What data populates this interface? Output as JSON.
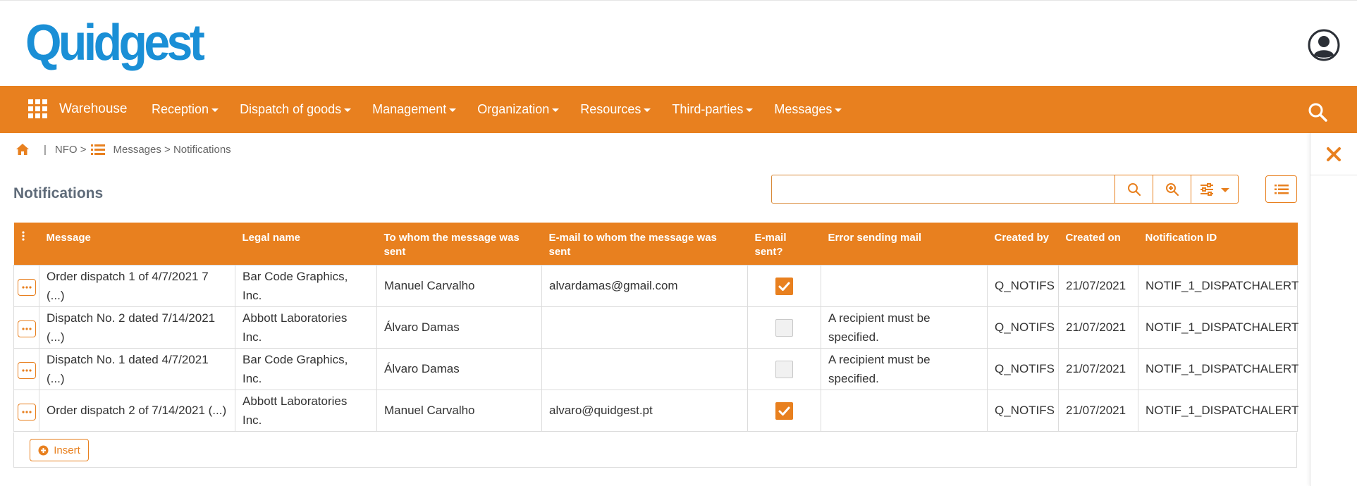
{
  "header": {
    "logo_text": "Quidgest",
    "icons": {
      "avatar": "user-avatar-icon",
      "apps": "grid-apps-icon",
      "search": "search-icon",
      "close": "close-icon"
    }
  },
  "nav": {
    "brand": "Warehouse",
    "items": [
      {
        "label": "Reception"
      },
      {
        "label": "Dispatch of goods"
      },
      {
        "label": "Management"
      },
      {
        "label": "Organization"
      },
      {
        "label": "Resources"
      },
      {
        "label": "Third-parties"
      },
      {
        "label": "Messages"
      }
    ]
  },
  "breadcrumb": {
    "separator": "|",
    "module": "NFO >",
    "path": "Messages > Notifications"
  },
  "page": {
    "title": "Notifications",
    "search_value": ""
  },
  "table": {
    "columns": [
      {
        "label": "Message"
      },
      {
        "label": "Legal name"
      },
      {
        "label": "To whom the message was sent"
      },
      {
        "label": "E-mail to whom the message was sent"
      },
      {
        "label": "E-mail sent?"
      },
      {
        "label": "Error sending mail"
      },
      {
        "label": "Created by"
      },
      {
        "label": "Created on"
      },
      {
        "label": "Notification ID"
      }
    ],
    "rows": [
      {
        "message": "Order dispatch 1 of 4/7/2021 7 (...)",
        "legal_name": "Bar Code Graphics, Inc.",
        "to_whom": "Manuel Carvalho",
        "email": "alvardamas@gmail.com",
        "sent": true,
        "error": "",
        "created_by": "Q_NOTIFS",
        "created_on": "21/07/2021",
        "notification_id": "NOTIF_1_DISPATCHALERT"
      },
      {
        "message": "Dispatch No. 2 dated 7/14/2021 (...)",
        "legal_name": "Abbott Laboratories Inc.",
        "to_whom": "Álvaro Damas",
        "email": "",
        "sent": false,
        "error": "A recipient must be specified.",
        "created_by": "Q_NOTIFS",
        "created_on": "21/07/2021",
        "notification_id": "NOTIF_1_DISPATCHALERT"
      },
      {
        "message": "Dispatch No. 1 dated 4/7/2021 (...)",
        "legal_name": "Bar Code Graphics, Inc.",
        "to_whom": "Álvaro Damas",
        "email": "",
        "sent": false,
        "error": "A recipient must be specified.",
        "created_by": "Q_NOTIFS",
        "created_on": "21/07/2021",
        "notification_id": "NOTIF_1_DISPATCHALERT"
      },
      {
        "message": "Order dispatch 2 of 7/14/2021 (...)",
        "legal_name": "Abbott Laboratories Inc.",
        "to_whom": "Manuel Carvalho",
        "email": "alvaro@quidgest.pt",
        "sent": true,
        "error": "",
        "created_by": "Q_NOTIFS",
        "created_on": "21/07/2021",
        "notification_id": "NOTIF_1_DISPATCHALERT"
      }
    ],
    "insert_label": "Insert"
  },
  "colors": {
    "accent": "#e8801f",
    "logo": "#1a8fd6",
    "title": "#5f6b79"
  }
}
